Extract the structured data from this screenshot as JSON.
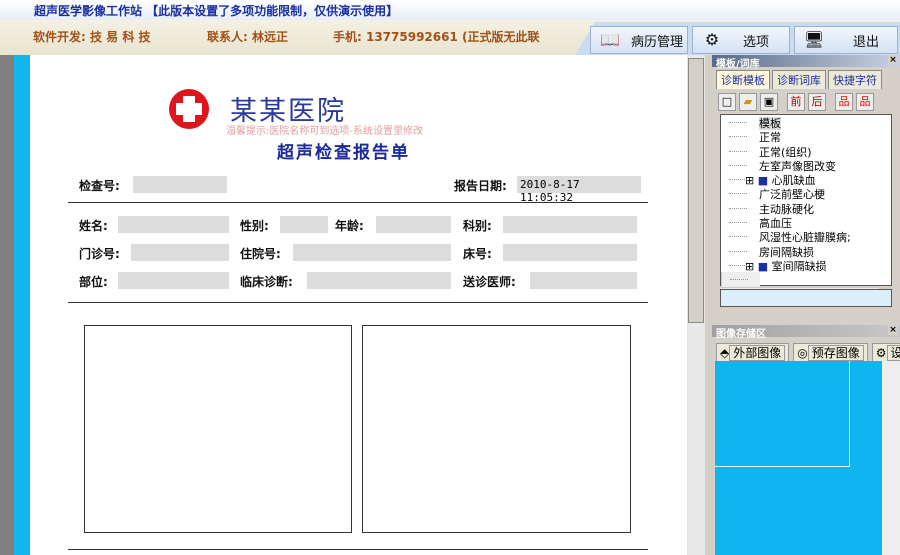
{
  "app": {
    "title": "超声医学影像工作站 【此版本设置了多项功能限制，仅供演示使用】"
  },
  "info": {
    "developer": "软件开发: 技 易 科 技",
    "contact": "联系人: 林远正",
    "phone": "手机: 13775992661 (正式版无此联"
  },
  "toolbar": {
    "records": "病历管理",
    "options": "选项",
    "exit": "退出"
  },
  "report": {
    "hospital": "某某医院",
    "hint": "温馨提示:医院名称可到选项-系统设置里修改",
    "title": "超声检查报告单",
    "exam_no_label": "检查号:",
    "date_label": "报告日期:",
    "date_value": "2010-8-17 11:05:32",
    "name": "姓名:",
    "sex": "性别:",
    "age": "年龄:",
    "dept": "科别:",
    "outpatient": "门诊号:",
    "inpatient": "住院号:",
    "bed": "床号:",
    "part": "部位:",
    "clinical": "临床诊断:",
    "doctor": "送诊医师:"
  },
  "template_panel": {
    "title": "模板/词库",
    "tabs": [
      "诊断模板",
      "诊断词库",
      "快捷字符"
    ],
    "items": [
      "模板",
      "正常",
      "正常(组织)",
      "左室声像图改变",
      "心肌缺血",
      "广泛前壁心梗",
      "主动脉硬化",
      "高血压",
      "风湿性心脏瓣膜病;",
      "房间隔缺损",
      "室间隔缺损"
    ]
  },
  "image_panel": {
    "title": "图像存储区",
    "external": "外部图像",
    "prestored": "预存图像",
    "settings": "设"
  }
}
